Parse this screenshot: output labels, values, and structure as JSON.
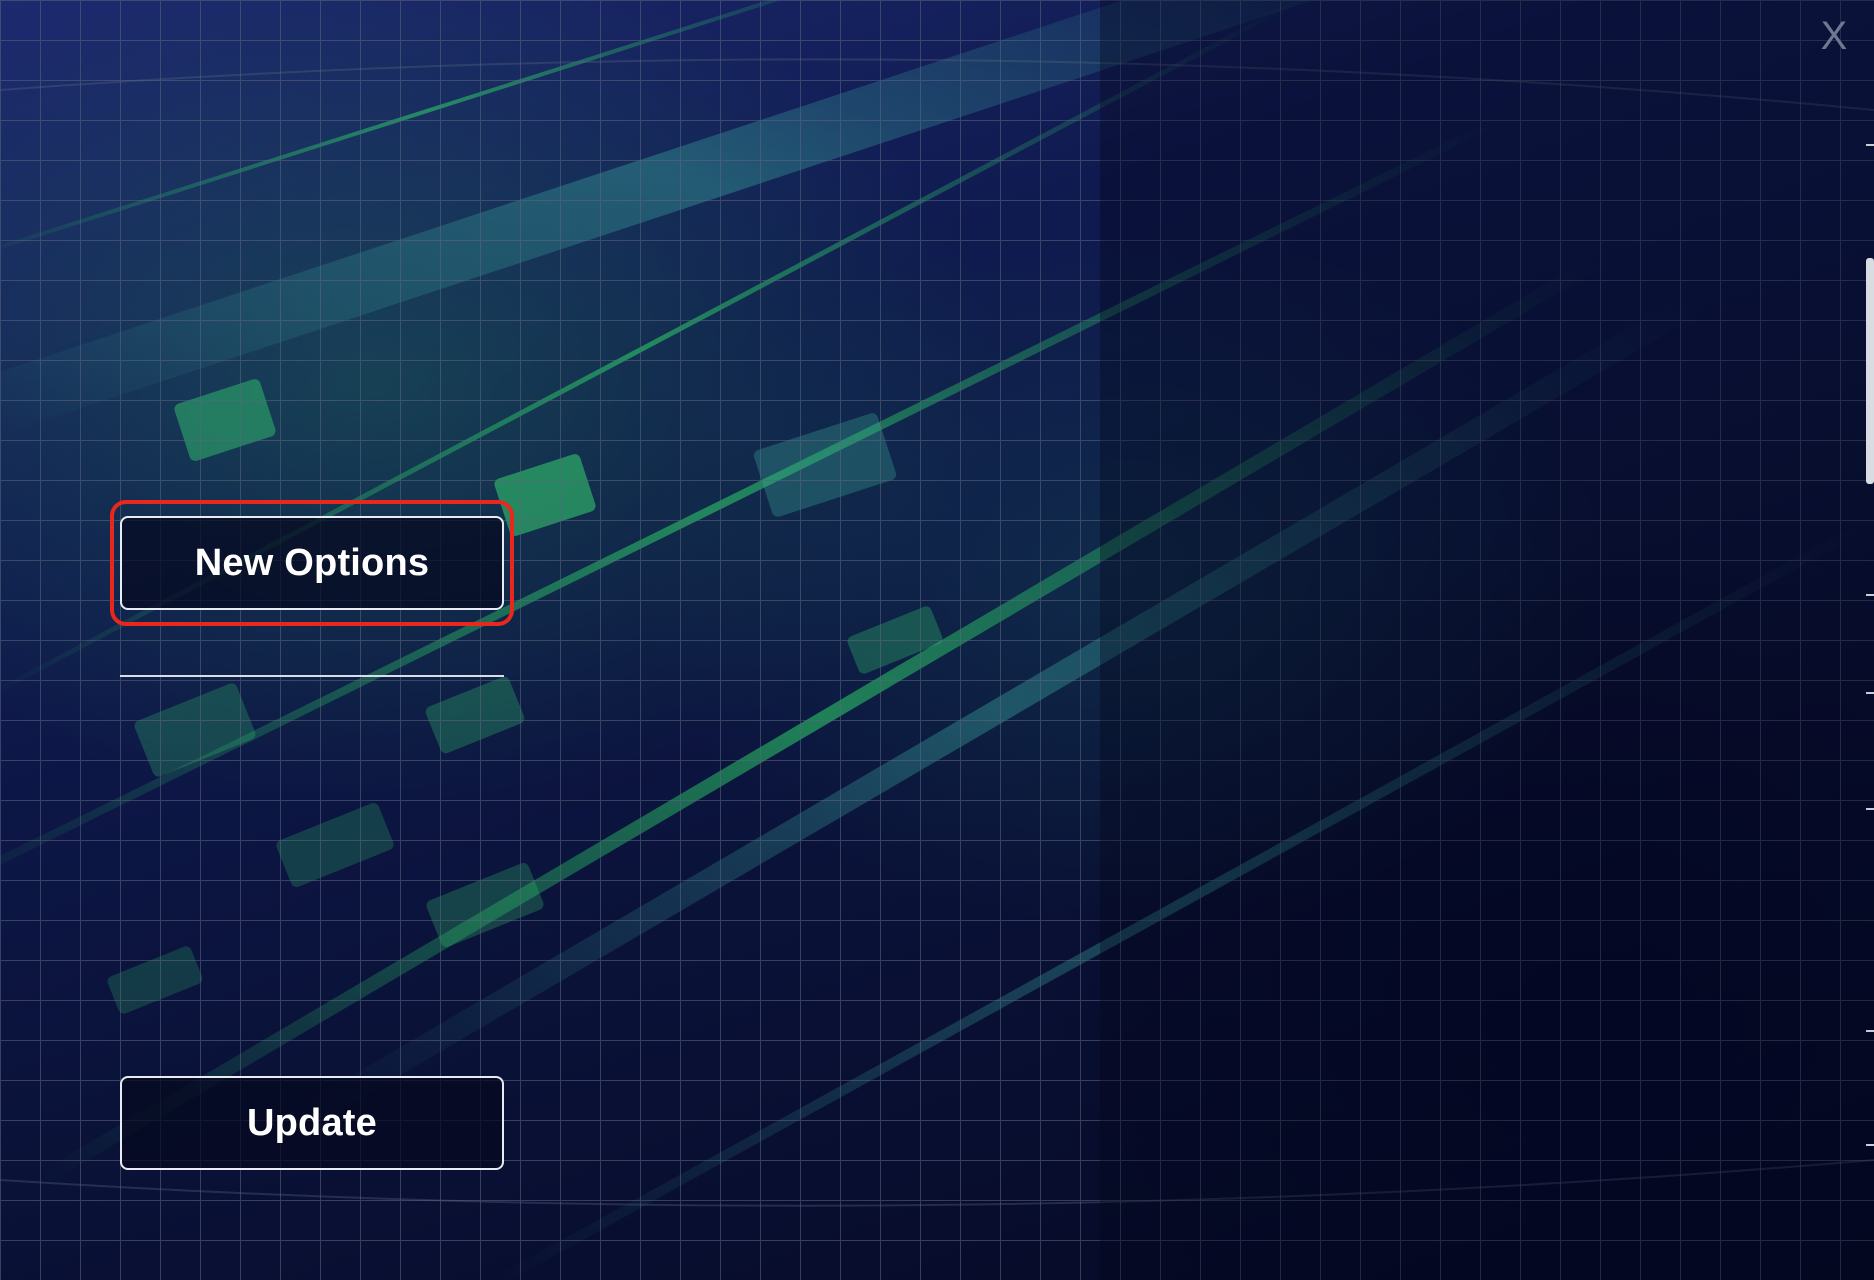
{
  "dialog": {
    "close_label": "X",
    "accent_color": "#e8281c",
    "background_color": "#070a26"
  },
  "buttons": {
    "new_options_label": "New Options",
    "update_label": "Update"
  },
  "icons": {
    "close": "close-icon"
  }
}
